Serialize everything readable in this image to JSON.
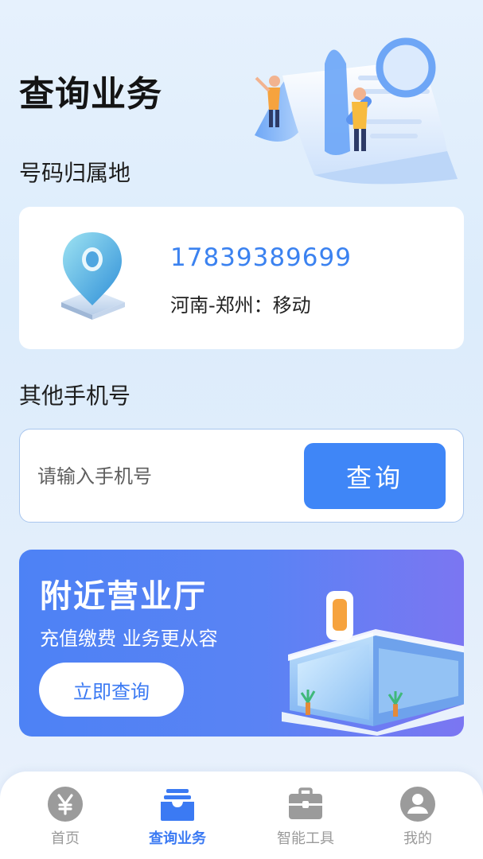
{
  "page": {
    "title": "查询业务"
  },
  "home_number": {
    "section_label": "号码归属地",
    "phone": "17839389699",
    "location_carrier": "河南-郑州：移动"
  },
  "other_number": {
    "section_label": "其他手机号",
    "input_placeholder": "请输入手机号",
    "input_value": "",
    "query_button_label": "查询"
  },
  "nearby_store_banner": {
    "title": "附近营业厅",
    "subtitle": "充值缴费 业务更从容",
    "button_label": "立即查询"
  },
  "tab_bar": {
    "items": [
      {
        "label": "首页",
        "icon": "yen-coin-icon",
        "active": false
      },
      {
        "label": "查询业务",
        "icon": "query-stack-icon",
        "active": true
      },
      {
        "label": "智能工具",
        "icon": "toolbox-icon",
        "active": false
      },
      {
        "label": "我的",
        "icon": "user-avatar-icon",
        "active": false
      }
    ]
  },
  "colors": {
    "accent": "#3f86f7",
    "phone_text": "#3b82f0",
    "banner_start": "#4d82f5",
    "banner_end": "#7b76f2",
    "tab_inactive": "#9a9a9a"
  }
}
